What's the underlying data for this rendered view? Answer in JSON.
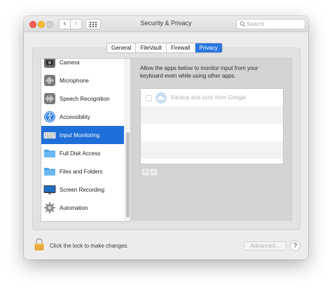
{
  "window": {
    "title": "Security & Privacy",
    "nav_back_glyph": "‹",
    "nav_forward_glyph": "›"
  },
  "search": {
    "placeholder": "Search",
    "icon": "magnifier"
  },
  "tabs": [
    {
      "label": "General",
      "active": false
    },
    {
      "label": "FileVault",
      "active": false
    },
    {
      "label": "Firewall",
      "active": false
    },
    {
      "label": "Privacy",
      "active": true
    }
  ],
  "sidebar": {
    "items": [
      {
        "label": "Camera",
        "icon": "camera-icon",
        "selected": false
      },
      {
        "label": "Microphone",
        "icon": "microphone-icon",
        "selected": false
      },
      {
        "label": "Speech Recognition",
        "icon": "waveform-icon",
        "selected": false
      },
      {
        "label": "Accessibility",
        "icon": "accessibility-icon",
        "selected": false
      },
      {
        "label": "Input Monitoring",
        "icon": "keyboard-icon",
        "selected": true
      },
      {
        "label": "Full Disk Access",
        "icon": "folder-icon",
        "selected": false
      },
      {
        "label": "Files and Folders",
        "icon": "folder-icon",
        "selected": false
      },
      {
        "label": "Screen Recording",
        "icon": "display-icon",
        "selected": false
      },
      {
        "label": "Automation",
        "icon": "gear-icon",
        "selected": false
      }
    ]
  },
  "main": {
    "description": "Allow the apps below to monitor input from your keyboard even while using other apps.",
    "apps": [
      {
        "name": "Backup and sync from Google",
        "icon": "cloud-icon",
        "checked": false
      }
    ],
    "add_label": "+",
    "remove_label": "−"
  },
  "footer": {
    "lock_text": "Click the lock to make changes.",
    "advanced_label": "Advanced...",
    "help_label": "?"
  },
  "colors": {
    "accent": "#1e6fd9",
    "tab_active": "#2a76e0",
    "close": "#fe5f57",
    "minimize": "#febc2e"
  }
}
